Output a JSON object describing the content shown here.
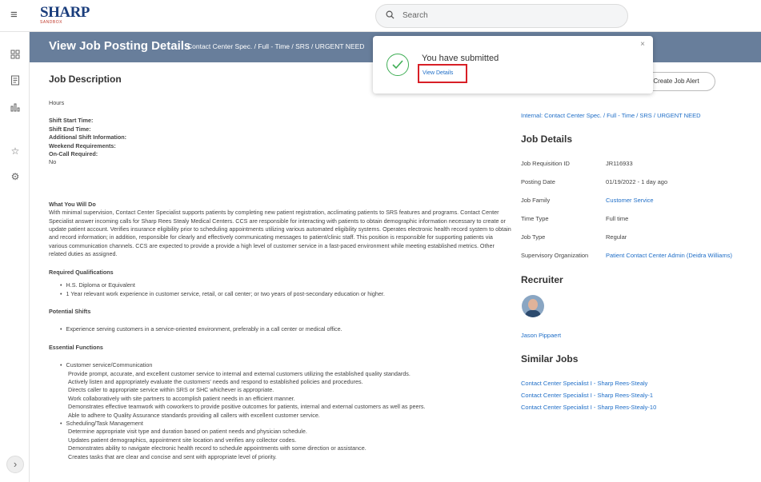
{
  "topbar": {
    "logo_main": "SHARP",
    "logo_sub": "SANDBOX",
    "search_placeholder": "Search"
  },
  "header": {
    "title": "View Job Posting Details",
    "subtitle": "Contact Center Spec. / Full - Time / SRS / URGENT NEED"
  },
  "job_description": {
    "section_title": "Job Description",
    "hours_label": "Hours",
    "shift_start": "Shift Start Time:",
    "shift_end": "Shift End Time:",
    "additional_shift": "Additional Shift Information:",
    "weekend": "Weekend Requirements:",
    "on_call": "On-Call Required:",
    "on_call_value": "No",
    "what_you_will_do_heading": "What You Will Do",
    "what_you_will_do_text": "With minimal supervision, Contact Center Specialist supports patients by completing new patient registration, acclimating patients to SRS features and programs. Contact Center Specialist answer incoming calls for Sharp Rees Stealy Medical Centers. CCS are responsible for interacting with patients to obtain demographic information necessary to create or update patient account. Verifies insurance eligibility prior to scheduling appointments utilizing various automated eligibility systems. Operates electronic health record system to obtain and record information; in addition, responsible for clearly and effectively communicating messages to patient/clinic staff. This position is responsible for supporting patients via various communication channels. CCS are expected to provide a provide a high level of customer service in a fast-paced environment while meeting established metrics. Other related duties as assigned.",
    "required_heading": "Required Qualifications",
    "required_items": [
      "H.S. Diploma or Equivalent",
      "1 Year relevant work experience in customer service, retail, or call center; or two years of post-secondary education or higher."
    ],
    "potential_heading": "Potential Shifts",
    "potential_items": [
      "Experience serving customers in a service-oriented environment, preferably in a call center or medical office."
    ],
    "essential_heading": "Essential Functions",
    "essential_group1": "Customer service/Communication",
    "essential_group1_items": [
      "Provide prompt, accurate, and excellent customer service to internal and external customers utilizing the established quality standards.",
      "Actively listen and appropriately evaluate the customers' needs and respond to established policies and procedures.",
      "Directs caller to appropriate service within SRS or SHC whichever is appropriate.",
      "Work collaboratively with site partners to accomplish patient needs in an efficient manner.",
      "Demonstrates effective teamwork with coworkers to provide positive outcomes for patients, internal and external customers as well as peers.",
      "Able to adhere to Quality Assurance standards providing all callers with excellent customer service."
    ],
    "essential_group2": "Scheduling/Task Management",
    "essential_group2_items": [
      "Determine appropriate visit type and duration based on patient needs and physician schedule.",
      "Updates patient demographics, appointment site location and verifies any collector codes.",
      "Demonstrates ability to navigate electronic health record to schedule appointments with some direction or assistance.",
      "Creates tasks that are clear and concise and sent with appropriate level of priority."
    ]
  },
  "right": {
    "create_alert": "Create Job Alert",
    "breadcrumb_link": "Internal: Contact Center Spec. / Full - Time / SRS / URGENT NEED",
    "job_details_heading": "Job Details",
    "details": [
      {
        "k": "Job Requisition ID",
        "v": "JR116933"
      },
      {
        "k": "Posting Date",
        "v": "01/19/2022 - 1 day ago"
      },
      {
        "k": "Job Family",
        "v": "Customer Service"
      },
      {
        "k": "Time Type",
        "v": "Full time"
      },
      {
        "k": "Job Type",
        "v": "Regular"
      },
      {
        "k": "Supervisory Organization",
        "v": "Patient Contact Center Admin (Deidra Williams)"
      }
    ],
    "recruiter_heading": "Recruiter",
    "recruiter_name": "Jason Pippaert",
    "similar_heading": "Similar Jobs",
    "similar_jobs": [
      "Contact Center Specialist I - Sharp Rees-Stealy",
      "Contact Center Specialist I - Sharp Rees-Stealy-1",
      "Contact Center Specialist I - Sharp Rees-Stealy-10"
    ]
  },
  "toast": {
    "title": "You have submitted",
    "link": "View Details",
    "close": "×"
  },
  "colors": {
    "header_band": "#687e9b",
    "link": "#1f6ec7",
    "success": "#3fae55",
    "highlight": "#d81f26"
  }
}
